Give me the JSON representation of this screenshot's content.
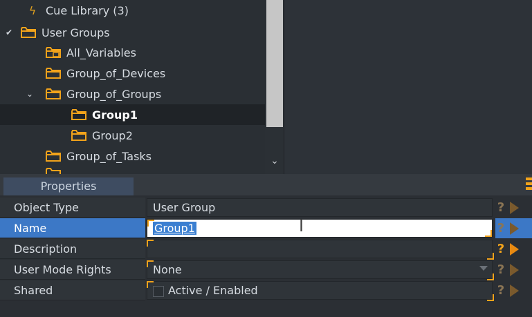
{
  "tree": {
    "items": [
      {
        "label": "Cue Library (3)",
        "icon": "lightning-bolt-icon",
        "expanded": false,
        "selected": false
      },
      {
        "label": "User Groups",
        "icon": "folder-icon",
        "expanded": true,
        "selected": false
      },
      {
        "label": "All_Variables",
        "icon": "variables-folder-icon",
        "selected": false
      },
      {
        "label": "Group_of_Devices",
        "icon": "folder-icon",
        "selected": false
      },
      {
        "label": "Group_of_Groups",
        "icon": "folder-icon",
        "expanded": true,
        "selected": false
      },
      {
        "label": "Group1",
        "icon": "folder-icon",
        "selected": true
      },
      {
        "label": "Group2",
        "icon": "folder-icon",
        "selected": false
      },
      {
        "label": "Group_of_Tasks",
        "icon": "folder-icon",
        "selected": false
      }
    ],
    "colors": {
      "folder": "#f2a31b",
      "background": "#2a2f34",
      "selected_background": "#1f2327"
    }
  },
  "properties": {
    "tab_label": "Properties",
    "rows": [
      {
        "label": "Object Type",
        "value": "User Group",
        "editing": false
      },
      {
        "label": "Name",
        "value": "Group1",
        "editing": true
      },
      {
        "label": "Description",
        "value": "",
        "editing": false
      },
      {
        "label": "User Mode Rights",
        "value": "None",
        "editing": false,
        "type": "select"
      },
      {
        "label": "Shared",
        "value": "Active / Enabled",
        "editing": false,
        "type": "checkbox",
        "checked": false
      }
    ],
    "helper_icons": [
      "question-icon",
      "play-arrow-icon"
    ],
    "colors": {
      "accent": "#f2a31b",
      "active_row": "#3c78c6",
      "tab": "#3e4c61"
    }
  }
}
